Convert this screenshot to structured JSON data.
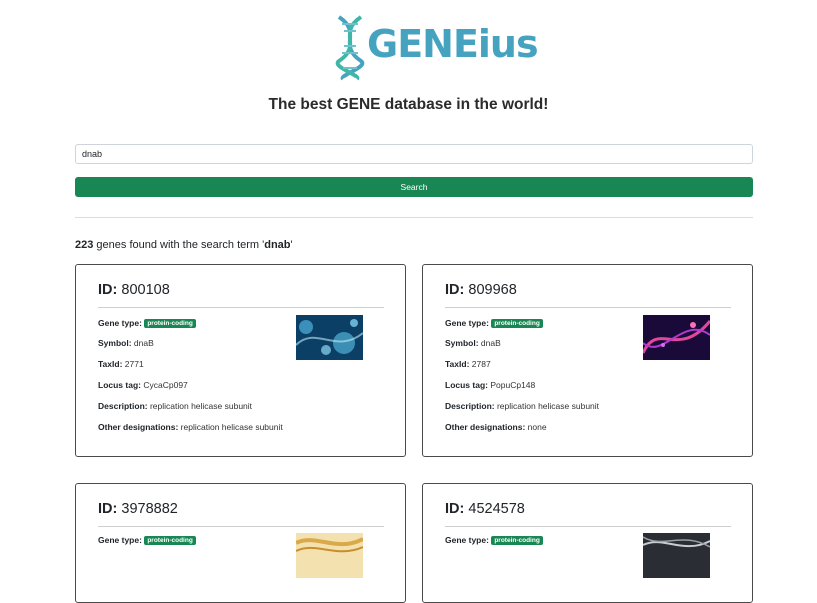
{
  "header": {
    "logo_text": "GENEius",
    "tagline": "The best GENE database in the world!"
  },
  "search": {
    "value": "dnab",
    "button_label": "Search"
  },
  "summary": {
    "count": "223",
    "text_before": " genes found with the search term '",
    "term": "dnab",
    "text_after": "'"
  },
  "labels": {
    "id": "ID:",
    "gene_type": "Gene type:",
    "symbol": "Symbol:",
    "taxid": "TaxId:",
    "locus_tag": "Locus tag:",
    "description": "Description:",
    "other_designations": "Other designations:"
  },
  "cards": [
    {
      "id": "800108",
      "gene_type": "protein-coding",
      "symbol": "dnaB",
      "taxid": "2771",
      "locus_tag": "CycaCp097",
      "description": "replication helicase subunit",
      "other_designations": "replication helicase subunit",
      "image": "blue-cell-image"
    },
    {
      "id": "809968",
      "gene_type": "protein-coding",
      "symbol": "dnaB",
      "taxid": "2787",
      "locus_tag": "PopuCp148",
      "description": "replication helicase subunit",
      "other_designations": "none",
      "image": "pink-dna-image"
    },
    {
      "id": "3978882",
      "gene_type": "protein-coding",
      "image": "yellow-dna-image"
    },
    {
      "id": "4524578",
      "gene_type": "protein-coding",
      "image": "gray-dna-image"
    }
  ],
  "colors": {
    "accent_green": "#198754",
    "logo_blue": "#45a3c0",
    "logo_teal": "#3fb6a8"
  }
}
